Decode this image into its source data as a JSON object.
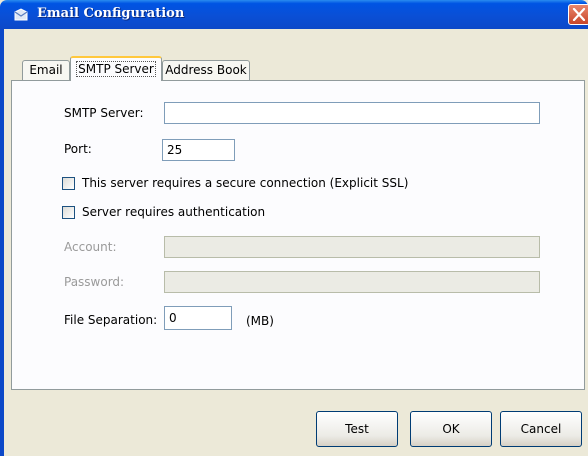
{
  "window": {
    "title": "Email Configuration"
  },
  "tabs": [
    {
      "label": "Email",
      "active": false
    },
    {
      "label": "SMTP Server",
      "active": true
    },
    {
      "label": "Address Book",
      "active": false
    }
  ],
  "form": {
    "smtp_server": {
      "label": "SMTP Server:",
      "value": ""
    },
    "port": {
      "label": "Port:",
      "value": "25"
    },
    "ssl": {
      "label": "This server requires a secure connection (Explicit SSL)",
      "checked": false
    },
    "auth": {
      "label": "Server requires authentication",
      "checked": false
    },
    "account": {
      "label": "Account:",
      "value": "",
      "disabled": true
    },
    "password": {
      "label": "Password:",
      "value": "",
      "disabled": true
    },
    "file_separation": {
      "label": "File Separation:",
      "value": "0",
      "unit": "(MB)"
    }
  },
  "buttons": {
    "test": "Test",
    "ok": "OK",
    "cancel": "Cancel"
  },
  "icons": {
    "title": "email-config-icon",
    "close": "close-icon"
  },
  "colors": {
    "titlebar": "#0054e3",
    "close_button": "#c8452a",
    "dialog_bg": "#ece9d8"
  }
}
